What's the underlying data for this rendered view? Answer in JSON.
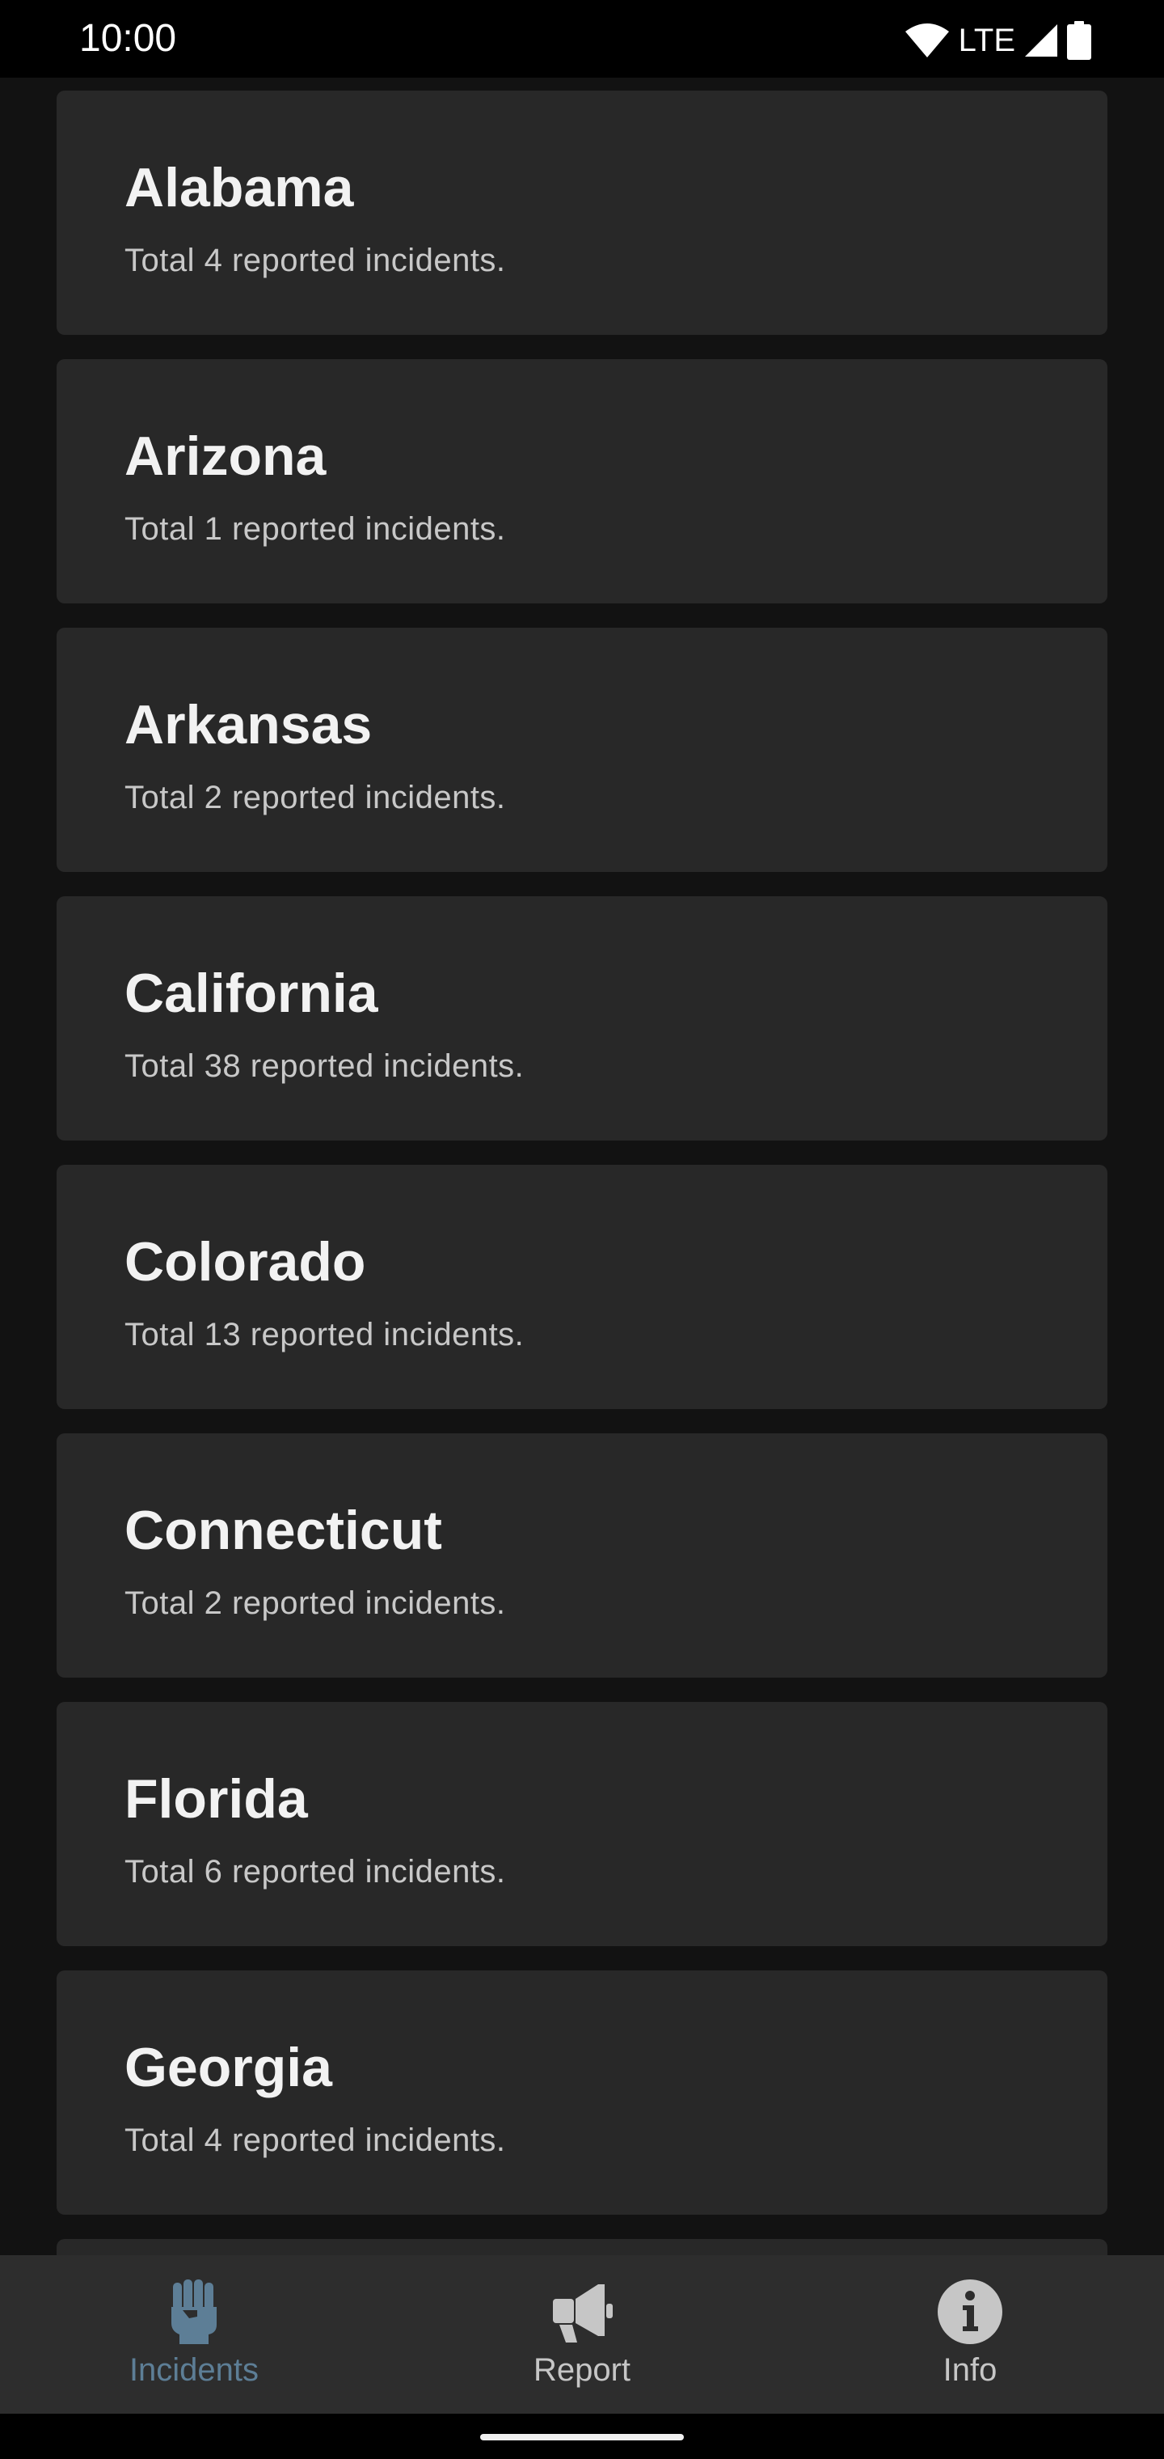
{
  "status_bar": {
    "time": "10:00",
    "network": "LTE"
  },
  "incidents": [
    {
      "state": "Alabama",
      "summary": "Total 4 reported incidents."
    },
    {
      "state": "Arizona",
      "summary": "Total 1 reported incidents."
    },
    {
      "state": "Arkansas",
      "summary": "Total 2 reported incidents."
    },
    {
      "state": "California",
      "summary": "Total 38 reported incidents."
    },
    {
      "state": "Colorado",
      "summary": "Total 13 reported incidents."
    },
    {
      "state": "Connecticut",
      "summary": "Total 2 reported incidents."
    },
    {
      "state": "Florida",
      "summary": "Total 6 reported incidents."
    },
    {
      "state": "Georgia",
      "summary": "Total 4 reported incidents."
    }
  ],
  "bottom_nav": {
    "items": [
      {
        "label": "Incidents",
        "icon": "raised-fist-icon",
        "active": true
      },
      {
        "label": "Report",
        "icon": "megaphone-icon",
        "active": false
      },
      {
        "label": "Info",
        "icon": "info-circle-icon",
        "active": false
      }
    ]
  },
  "colors": {
    "background": "#121212",
    "card": "#282828",
    "nav_background": "#2d2d2d",
    "active_accent": "#5d7e96",
    "inactive_label": "#c6c6c6"
  }
}
